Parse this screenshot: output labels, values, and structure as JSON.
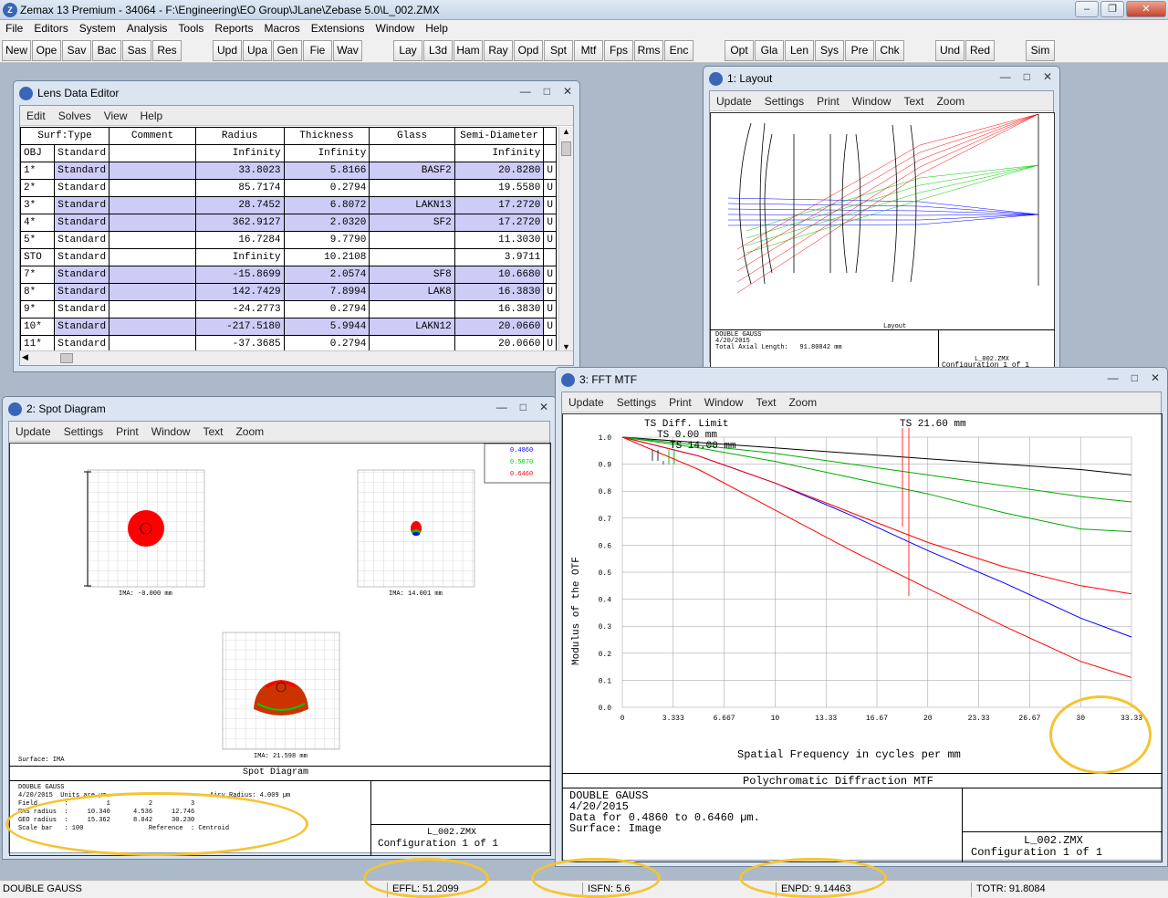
{
  "app": {
    "title": "Zemax 13 Premium - 34064 - F:\\Engineering\\EO Group\\JLane\\Zebase 5.0\\L_002.ZMX",
    "logo": "Z"
  },
  "menu": [
    "File",
    "Editors",
    "System",
    "Analysis",
    "Tools",
    "Reports",
    "Macros",
    "Extensions",
    "Window",
    "Help"
  ],
  "toolbar": [
    "New",
    "Ope",
    "Sav",
    "Bac",
    "Sas",
    "Res",
    "Upd",
    "Upa",
    "Gen",
    "Fie",
    "Wav",
    "Lay",
    "L3d",
    "Ham",
    "Ray",
    "Opd",
    "Spt",
    "Mtf",
    "Fps",
    "Rms",
    "Enc",
    "Opt",
    "Gla",
    "Len",
    "Sys",
    "Pre",
    "Chk",
    "Und",
    "Red",
    "Sim"
  ],
  "lde": {
    "title": "Lens Data Editor",
    "menu": [
      "Edit",
      "Solves",
      "View",
      "Help"
    ],
    "columns": [
      "Surf:Type",
      "Comment",
      "Radius",
      "Thickness",
      "Glass",
      "Semi-Diameter"
    ],
    "rows": [
      {
        "surf": "OBJ",
        "type": "Standard",
        "comment": "",
        "radius": "Infinity",
        "thickness": "Infinity",
        "glass": "",
        "semi": "Infinity",
        "flag": "",
        "sel": false
      },
      {
        "surf": "1*",
        "type": "Standard",
        "comment": "",
        "radius": "33.8023",
        "thickness": "5.8166",
        "glass": "BASF2",
        "semi": "20.8280",
        "flag": "U",
        "sel": true
      },
      {
        "surf": "2*",
        "type": "Standard",
        "comment": "",
        "radius": "85.7174",
        "thickness": "0.2794",
        "glass": "",
        "semi": "19.5580",
        "flag": "U",
        "sel": false
      },
      {
        "surf": "3*",
        "type": "Standard",
        "comment": "",
        "radius": "28.7452",
        "thickness": "6.8072",
        "glass": "LAKN13",
        "semi": "17.2720",
        "flag": "U",
        "sel": true
      },
      {
        "surf": "4*",
        "type": "Standard",
        "comment": "",
        "radius": "362.9127",
        "thickness": "2.0320",
        "glass": "SF2",
        "semi": "17.2720",
        "flag": "U",
        "sel": true
      },
      {
        "surf": "5*",
        "type": "Standard",
        "comment": "",
        "radius": "16.7284",
        "thickness": "9.7790",
        "glass": "",
        "semi": "11.3030",
        "flag": "U",
        "sel": false
      },
      {
        "surf": "STO",
        "type": "Standard",
        "comment": "",
        "radius": "Infinity",
        "thickness": "10.2108",
        "glass": "",
        "semi": "3.9711",
        "flag": "",
        "sel": false
      },
      {
        "surf": "7*",
        "type": "Standard",
        "comment": "",
        "radius": "-15.8699",
        "thickness": "2.0574",
        "glass": "SF8",
        "semi": "10.6680",
        "flag": "U",
        "sel": true
      },
      {
        "surf": "8*",
        "type": "Standard",
        "comment": "",
        "radius": "142.7429",
        "thickness": "7.8994",
        "glass": "LAK8",
        "semi": "16.3830",
        "flag": "U",
        "sel": true
      },
      {
        "surf": "9*",
        "type": "Standard",
        "comment": "",
        "radius": "-24.2773",
        "thickness": "0.2794",
        "glass": "",
        "semi": "16.3830",
        "flag": "U",
        "sel": false
      },
      {
        "surf": "10*",
        "type": "Standard",
        "comment": "",
        "radius": "-217.5180",
        "thickness": "5.9944",
        "glass": "LAKN12",
        "semi": "20.0660",
        "flag": "U",
        "sel": true
      },
      {
        "surf": "11*",
        "type": "Standard",
        "comment": "",
        "radius": "-37.3685",
        "thickness": "0.2794",
        "glass": "",
        "semi": "20.0660",
        "flag": "U",
        "sel": false
      }
    ]
  },
  "layout": {
    "title": "1: Layout",
    "menu": [
      "Update",
      "Settings",
      "Print",
      "Window",
      "Text",
      "Zoom"
    ],
    "caption": "Layout",
    "info_name": "DOUBLE GAUSS",
    "info_date": "4/20/2015",
    "info_length": "Total Axial Length:   91.80842 mm",
    "file": "L_002.ZMX",
    "config": "Configuration 1 of 1"
  },
  "spot": {
    "title": "2: Spot Diagram",
    "menu": [
      "Update",
      "Settings",
      "Print",
      "Window",
      "Text",
      "Zoom"
    ],
    "wavelengths": [
      "0.4860",
      "0.5870",
      "0.6460"
    ],
    "wave_colors": [
      "#0000ff",
      "#00cc00",
      "#ff0000"
    ],
    "fields": [
      "IMA: -0.000 mm",
      "IMA: 14.001 mm",
      "IMA: 21.598 mm"
    ],
    "surface": "Surface: IMA",
    "caption": "Spot Diagram",
    "info": [
      "DOUBLE GAUSS",
      "4/20/2015  Units are µm.                          Airy Radius: 4.009 µm",
      "Field       :          1          2          3",
      "RMS radius  :     10.340      4.536     12.746",
      "GEO radius  :     15.362      8.042     30.230",
      "Scale bar   : 100                 Reference  : Centroid"
    ],
    "file": "L_002.ZMX",
    "config": "Configuration 1 of 1"
  },
  "mtf": {
    "title": "3: FFT MTF",
    "menu": [
      "Update",
      "Settings",
      "Print",
      "Window",
      "Text",
      "Zoom"
    ],
    "legend": [
      "TS Diff. Limit",
      "TS 0.00 mm",
      "TS 14.00 mm",
      "TS 21.60 mm"
    ],
    "ylabel": "Modulus of the OTF",
    "xlabel": "Spatial Frequency in cycles per mm",
    "xticks": [
      "0",
      "3.333",
      "6.667",
      "10",
      "13.33",
      "16.67",
      "20",
      "23.33",
      "26.67",
      "30",
      "33.33"
    ],
    "yticks": [
      "1.0",
      "0.9",
      "0.8",
      "0.7",
      "0.6",
      "0.5",
      "0.4",
      "0.3",
      "0.2",
      "0.1",
      "0.0"
    ],
    "caption": "Polychromatic Diffraction MTF",
    "info": [
      "DOUBLE GAUSS",
      "4/20/2015",
      "Data for 0.4860 to 0.6460 µm.",
      "Surface: Image"
    ],
    "file": "L_002.ZMX",
    "config": "Configuration 1 of 1"
  },
  "chart_data": {
    "type": "line",
    "xlim": [
      0,
      33.33
    ],
    "ylim": [
      0,
      1
    ],
    "grid": true,
    "series": [
      {
        "name": "TS Diff. Limit",
        "color": "#000000",
        "x": [
          0,
          5,
          10,
          15,
          20,
          25,
          30,
          33.33
        ],
        "y": [
          1.0,
          0.98,
          0.96,
          0.94,
          0.92,
          0.9,
          0.88,
          0.86
        ]
      },
      {
        "name": "TS 0.00 mm",
        "color": "#0000ff",
        "x": [
          0,
          5,
          10,
          15,
          20,
          25,
          30,
          33.33
        ],
        "y": [
          1.0,
          0.93,
          0.83,
          0.71,
          0.58,
          0.46,
          0.33,
          0.26
        ]
      },
      {
        "name": "TS 14.00 mm",
        "color": "#00aa00",
        "x": [
          0,
          5,
          10,
          15,
          20,
          25,
          30,
          33.33
        ],
        "y": [
          1.0,
          0.97,
          0.94,
          0.9,
          0.86,
          0.82,
          0.78,
          0.76
        ]
      },
      {
        "name": "TS 14.00 mm",
        "color": "#00aa00",
        "x": [
          0,
          5,
          10,
          15,
          20,
          25,
          30,
          33.33
        ],
        "y": [
          1.0,
          0.96,
          0.91,
          0.85,
          0.79,
          0.72,
          0.66,
          0.65
        ]
      },
      {
        "name": "TS 21.60 mm",
        "color": "#ff0000",
        "x": [
          0,
          5,
          10,
          15,
          20,
          25,
          30,
          33.33
        ],
        "y": [
          1.0,
          0.93,
          0.83,
          0.72,
          0.61,
          0.52,
          0.45,
          0.42
        ]
      },
      {
        "name": "TS 21.60 mm",
        "color": "#ff0000",
        "x": [
          0,
          5,
          10,
          15,
          20,
          25,
          30,
          33.33
        ],
        "y": [
          1.0,
          0.88,
          0.73,
          0.58,
          0.44,
          0.3,
          0.17,
          0.11
        ]
      }
    ]
  },
  "status": {
    "name": "DOUBLE GAUSS",
    "effl": "EFFL: 51.2099",
    "isfn": "ISFN: 5.6",
    "enpd": "ENPD: 9.14463",
    "totr": "TOTR: 91.8084"
  }
}
